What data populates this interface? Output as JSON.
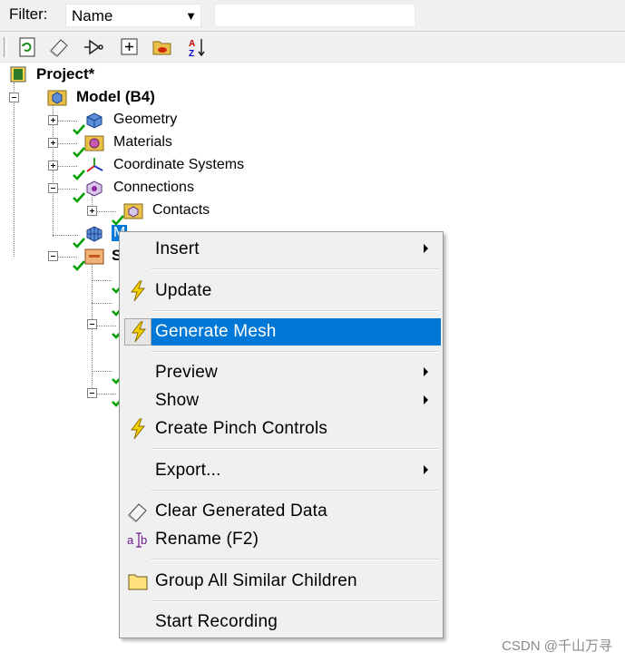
{
  "filter": {
    "label": "Filter:",
    "selected": "Name",
    "text_value": ""
  },
  "toolbar": {
    "buttons": [
      {
        "name": "refresh-icon"
      },
      {
        "name": "clear-icon"
      },
      {
        "name": "suppress-icon"
      },
      {
        "name": "expand-all-icon"
      },
      {
        "name": "folder-icon"
      },
      {
        "name": "sort-az-icon"
      }
    ]
  },
  "tree": {
    "project": "Project*",
    "model": "Model (B4)",
    "geometry": "Geometry",
    "materials": "Materials",
    "coordinate_systems": "Coordinate Systems",
    "connections": "Connections",
    "contacts": "Contacts",
    "mesh_partial": "M",
    "static_partial": "S"
  },
  "context_menu": {
    "insert": "Insert",
    "update": "Update",
    "generate_mesh": "Generate Mesh",
    "preview": "Preview",
    "show": "Show",
    "create_pinch_controls": "Create Pinch Controls",
    "export": "Export...",
    "clear_generated_data": "Clear Generated Data",
    "rename": "Rename (F2)",
    "group_all_similar_children": "Group All Similar Children",
    "start_recording": "Start Recording"
  },
  "colors": {
    "highlight": "#0078d7",
    "check": "#00a000",
    "lightning": "#f5d000"
  },
  "watermark": "CSDN @千山万寻"
}
